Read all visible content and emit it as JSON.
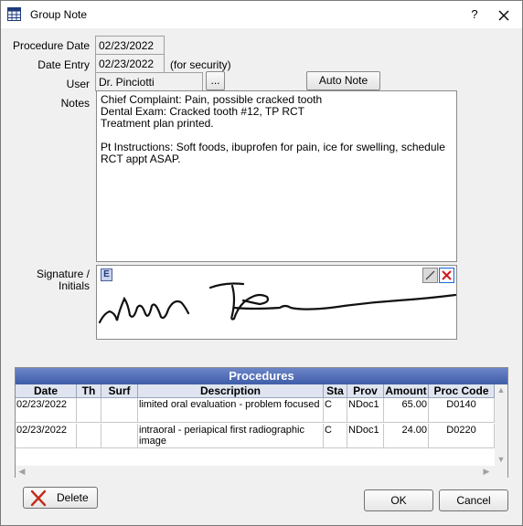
{
  "window": {
    "title": "Group Note",
    "help_label": "?"
  },
  "form": {
    "procedure_date_label": "Procedure Date",
    "procedure_date_value": "02/23/2022",
    "date_entry_label": "Date Entry",
    "date_entry_value": "02/23/2022",
    "for_security_label": "(for security)",
    "user_label": "User",
    "user_value": "Dr. Pinciotti",
    "user_picker_label": "...",
    "auto_note_label": "Auto Note",
    "notes_label": "Notes",
    "notes_text": "Chief Complaint: Pain, possible cracked tooth\nDental Exam: Cracked tooth #12, TP RCT\nTreatment plan printed.\n\nPt Instructions: Soft foods, ibuprofen for pain, ice for swelling, schedule RCT appt ASAP.",
    "signature_label_line1": "Signature /",
    "signature_label_line2": "Initials",
    "signature_e_label": "E"
  },
  "procedures": {
    "title": "Procedures",
    "columns": [
      "Date",
      "Th",
      "Surf",
      "Description",
      "Sta",
      "Prov",
      "Amount",
      "Proc Code"
    ],
    "rows": [
      {
        "date": "02/23/2022",
        "th": "",
        "surf": "",
        "description": "limited oral evaluation - problem focused",
        "sta": "C",
        "prov": "NDoc1",
        "amount": "65.00",
        "proc_code": "D0140"
      },
      {
        "date": "02/23/2022",
        "th": "",
        "surf": "",
        "description": "intraoral - periapical first radiographic image",
        "sta": "C",
        "prov": "NDoc1",
        "amount": "24.00",
        "proc_code": "D0220"
      }
    ]
  },
  "buttons": {
    "delete": "Delete",
    "ok": "OK",
    "cancel": "Cancel"
  },
  "colors": {
    "grid_title_bg": "#4a67b3",
    "delete_x": "#c42b1c",
    "sig_clear_red": "#d11a1a"
  }
}
